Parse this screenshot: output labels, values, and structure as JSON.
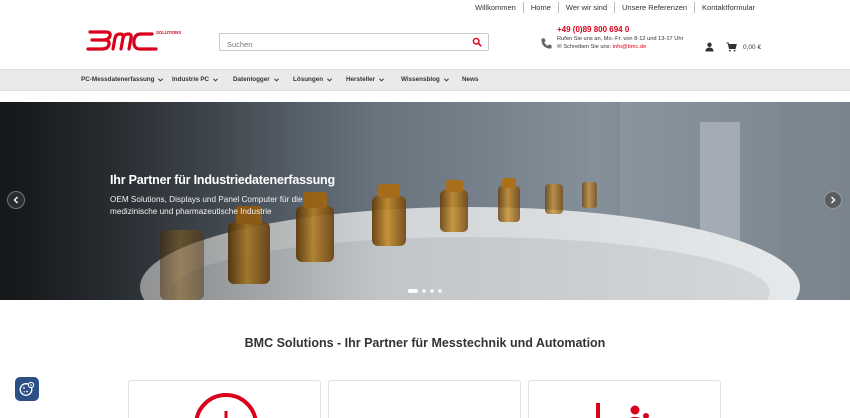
{
  "toplinks": [
    "Willkommen",
    "Home",
    "Wer wir sind",
    "Unsere Referenzen",
    "Kontaktformular"
  ],
  "logo": {
    "text": "BMC",
    "tagline": "SOLUTIONS"
  },
  "search": {
    "placeholder": "Suchen",
    "icon": "search-icon"
  },
  "contact": {
    "phone": "+49 (0)89 800 694 0",
    "hours": "Rufen Sie uns an, Mo.-Fr. von 8-12 und 13-17 Uhr",
    "mail_label": "Schreiben Sie uns:",
    "mail": "info@bmc.de"
  },
  "cart": {
    "total": "0,00 €"
  },
  "nav": [
    {
      "label": "PC-Messdatenerfassung"
    },
    {
      "label": "Industrie PC"
    },
    {
      "label": "Datenlogger"
    },
    {
      "label": "Lösungen"
    },
    {
      "label": "Hersteller"
    },
    {
      "label": "Wissensblog"
    },
    {
      "label": "News"
    }
  ],
  "hero": {
    "title": "Ihr Partner für Industriedatenerfassung",
    "subtitle": "OEM Solutions, Displays und Panel Computer für die medizinische und pharmazeutische Industrie",
    "slide_count": 4,
    "active_slide": 1
  },
  "section": {
    "title": "BMC Solutions - Ihr Partner für Messtechnik und Automation"
  },
  "colors": {
    "brand_red": "#d9001b",
    "nav_bg": "#e9eaeb",
    "cookie_bg": "#2c4f86"
  }
}
